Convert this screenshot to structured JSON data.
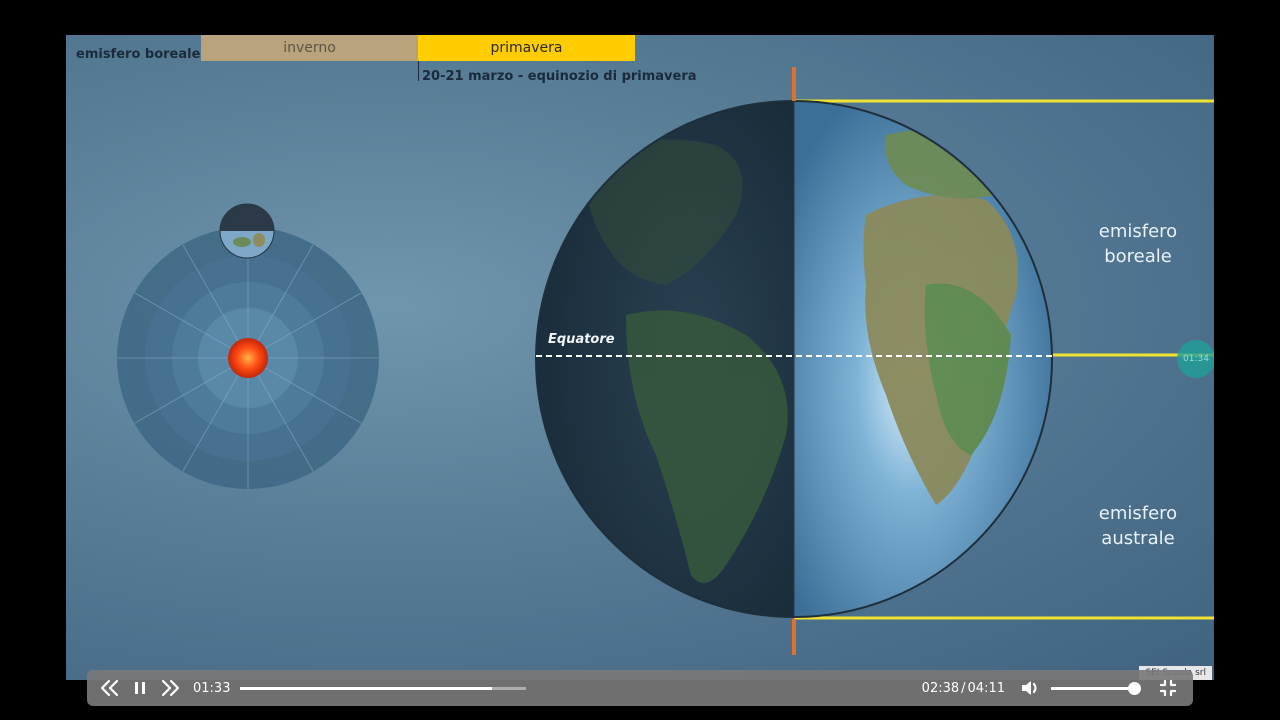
{
  "timeline": {
    "label": "emisfero boreale",
    "seasons": [
      {
        "name": "inverno",
        "color": "#b9a37c",
        "text_color": "#5e5444",
        "active": false
      },
      {
        "name": "primavera",
        "color": "#ffcd00",
        "text_color": "#2a2a2a",
        "active": true
      }
    ],
    "date_caption": "20-21 marzo - equinozio di primavera"
  },
  "diagram": {
    "hemispheres": {
      "north": [
        "emisfero",
        "boreale"
      ],
      "south": [
        "emisfero",
        "australe"
      ]
    },
    "equator_label": "Equatore",
    "colors": {
      "sun_beam": "#f2e230",
      "axis": "#e0702a",
      "equator": "#ffffff"
    }
  },
  "overlay": {
    "time_badge": "01:34",
    "credit": "SEI Scuola srl"
  },
  "player": {
    "current_time": "01:33",
    "progress_fraction": 0.88,
    "elapsed": "02:38",
    "separator": "/",
    "duration": "04:11",
    "volume_fraction": 0.98,
    "icons": [
      "rewind-icon",
      "pause-icon",
      "forward-icon",
      "volume-icon",
      "exit-fullscreen-icon"
    ]
  }
}
